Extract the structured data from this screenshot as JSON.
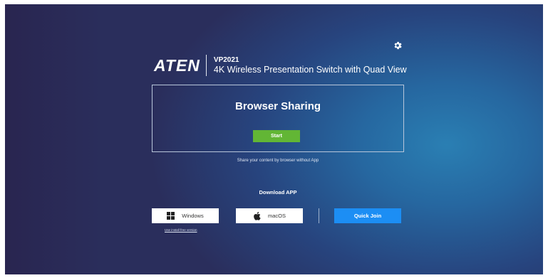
{
  "header": {
    "logo": "ATEN",
    "model": "VP2021",
    "product_name": "4K Wireless Presentation Switch with Quad View",
    "settings_icon": "gear-icon"
  },
  "browser_sharing": {
    "title": "Browser Sharing",
    "start_label": "Start",
    "description": "Share your content by browser without App"
  },
  "download": {
    "title": "Download APP",
    "windows_label": "Windows",
    "windows_icon": "windows-icon",
    "macos_label": "macOS",
    "macos_icon": "apple-icon",
    "quick_join_label": "Quick Join",
    "install_free_link": "Use install free version"
  },
  "colors": {
    "start_button": "#62b635",
    "quick_join_button": "#1c8ef4"
  }
}
